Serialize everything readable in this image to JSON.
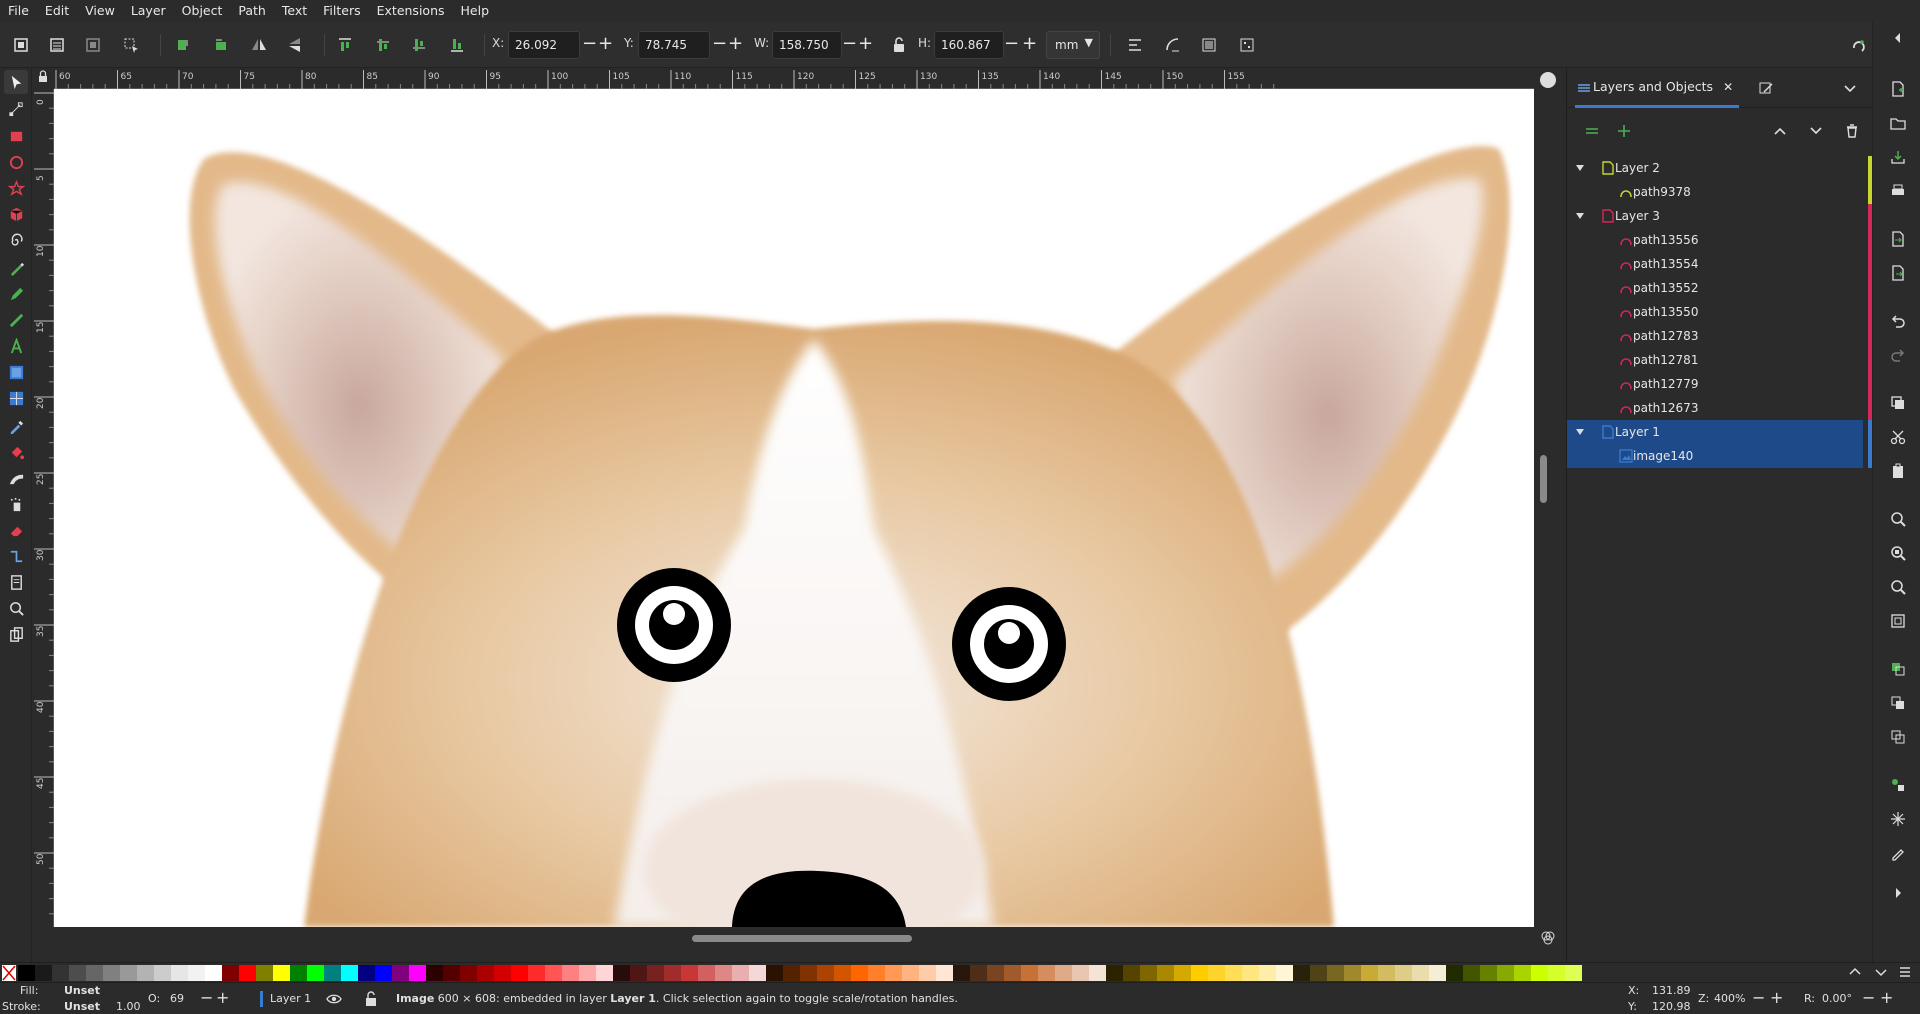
{
  "menu": [
    "File",
    "Edit",
    "View",
    "Layer",
    "Object",
    "Path",
    "Text",
    "Filters",
    "Extensions",
    "Help"
  ],
  "toolbar": {
    "x_label": "X:",
    "x_value": "26.092",
    "y_label": "Y:",
    "y_value": "78.745",
    "w_label": "W:",
    "w_value": "158.750",
    "h_label": "H:",
    "h_value": "160.867",
    "unit": "mm"
  },
  "ruler": {
    "h_ticks": [
      "60",
      "65",
      "70",
      "75",
      "80",
      "85",
      "90",
      "95",
      "100",
      "105",
      "110",
      "115",
      "120",
      "125",
      "130",
      "135",
      "140",
      "145",
      "150",
      "155"
    ],
    "v_ticks": [
      "0",
      "5",
      "10",
      "15",
      "20",
      "25",
      "30",
      "35",
      "40",
      "45",
      "50"
    ]
  },
  "panel": {
    "tab_label": "Layers and Objects",
    "items": [
      {
        "label": "Layer 2",
        "kind": "layer",
        "color": "#c8d630"
      },
      {
        "label": "path9378",
        "kind": "path",
        "color": "#c8d630"
      },
      {
        "label": "Layer 3",
        "kind": "layer",
        "color": "#d4285a"
      },
      {
        "label": "path13556",
        "kind": "path",
        "color": "#d4285a"
      },
      {
        "label": "path13554",
        "kind": "path",
        "color": "#d4285a"
      },
      {
        "label": "path13552",
        "kind": "path",
        "color": "#d4285a"
      },
      {
        "label": "path13550",
        "kind": "path",
        "color": "#d4285a"
      },
      {
        "label": "path12783",
        "kind": "path",
        "color": "#d4285a"
      },
      {
        "label": "path12781",
        "kind": "path",
        "color": "#d4285a"
      },
      {
        "label": "path12779",
        "kind": "path",
        "color": "#d4285a"
      },
      {
        "label": "path12673",
        "kind": "path",
        "color": "#d4285a"
      },
      {
        "label": "Layer 1",
        "kind": "layer",
        "color": "#3a7ad0"
      },
      {
        "label": "image140",
        "kind": "image",
        "color": "#3a7ad0"
      }
    ]
  },
  "status": {
    "fill_label": "Fill:",
    "fill_value": "Unset",
    "stroke_label": "Stroke:",
    "stroke_value": "Unset",
    "stroke_width": "1.00",
    "opacity_label": "O:",
    "opacity_value": "69",
    "layer_name": "Layer 1",
    "message_bold": "Image",
    "message_a": " 600 × 608: embedded in layer ",
    "message_layer": "Layer 1",
    "message_b": ". Click selection again to toggle scale/rotation handles.",
    "cursor_x_label": "X:",
    "cursor_x": "131.89",
    "cursor_y_label": "Y:",
    "cursor_y": "120.98",
    "zoom_label": "Z:",
    "zoom": "400%",
    "rotation_label": "R:",
    "rotation": "0.00°"
  },
  "colors": {
    "accent": "#3a7ad0",
    "layer2": "#c8d630",
    "layer3": "#d4285a"
  }
}
